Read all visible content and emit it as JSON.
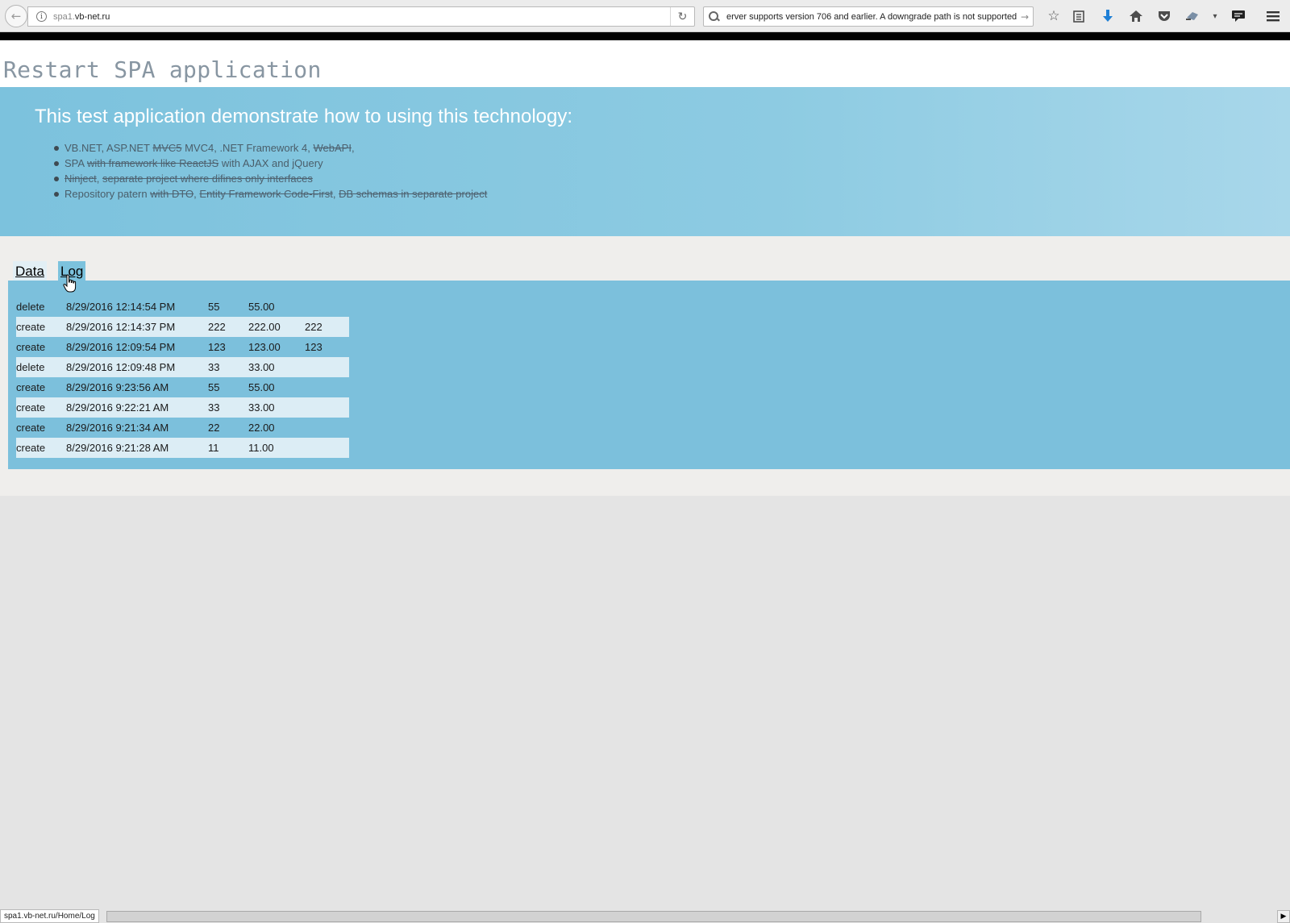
{
  "browser": {
    "url_host": "spa1.",
    "url_domain": "vb-net.ru",
    "search_text": "erver supports version 706 and earlier. A downgrade path is not supported.",
    "status_url": "spa1.vb-net.ru/Home/Log"
  },
  "page": {
    "title": "Restart SPA application",
    "hero_heading": "This test application demonstrate how to using this technology:",
    "tech_items": [
      {
        "parts": [
          {
            "t": "VB.NET, ASP.NET "
          },
          {
            "t": "MVC5",
            "s": true
          },
          {
            "t": " MVC4, .NET Framework 4, "
          },
          {
            "t": "WebAPI",
            "s": true
          },
          {
            "t": ","
          }
        ]
      },
      {
        "parts": [
          {
            "t": "SPA "
          },
          {
            "t": "with framework like ReactJS",
            "s": true
          },
          {
            "t": " with AJAX and jQuery"
          }
        ]
      },
      {
        "parts": [
          {
            "t": "Ninject",
            "s": true
          },
          {
            "t": ", "
          },
          {
            "t": "separate project where difines only interfaces",
            "s": true
          }
        ]
      },
      {
        "parts": [
          {
            "t": "Repository patern "
          },
          {
            "t": "with DTO",
            "s": true
          },
          {
            "t": ", "
          },
          {
            "t": "Entity Framework Code-First",
            "s": true
          },
          {
            "t": ", "
          },
          {
            "t": "DB schemas in separate project",
            "s": true
          }
        ]
      }
    ],
    "tabs": [
      {
        "label": "Data"
      },
      {
        "label": "Log"
      }
    ],
    "log_rows": [
      {
        "action": "delete",
        "date": "8/29/2016 12:14:54 PM",
        "id": "55",
        "price": "55.00",
        "name": ""
      },
      {
        "action": "create",
        "date": "8/29/2016 12:14:37 PM",
        "id": "222",
        "price": "222.00",
        "name": "222"
      },
      {
        "action": "create",
        "date": "8/29/2016 12:09:54 PM",
        "id": "123",
        "price": "123.00",
        "name": "123"
      },
      {
        "action": "delete",
        "date": "8/29/2016 12:09:48 PM",
        "id": "33",
        "price": "33.00",
        "name": ""
      },
      {
        "action": "create",
        "date": "8/29/2016 9:23:56 AM",
        "id": "55",
        "price": "55.00",
        "name": ""
      },
      {
        "action": "create",
        "date": "8/29/2016 9:22:21 AM",
        "id": "33",
        "price": "33.00",
        "name": ""
      },
      {
        "action": "create",
        "date": "8/29/2016 9:21:34 AM",
        "id": "22",
        "price": "22.00",
        "name": ""
      },
      {
        "action": "create",
        "date": "8/29/2016 9:21:28 AM",
        "id": "11",
        "price": "11.00",
        "name": ""
      }
    ]
  },
  "icons": {
    "back": "back-arrow-icon",
    "info": "info-icon",
    "reload": "reload-icon",
    "search": "search-icon",
    "bookmark_star": "star-icon",
    "reading_list": "clipboard-icon",
    "download": "download-arrow-icon",
    "home": "home-icon",
    "pocket": "pocket-icon",
    "sync": "sync-icon",
    "feedback": "speech-bubble-icon",
    "menu": "hamburger-menu-icon"
  },
  "colors": {
    "hero_bg": "#7cc2dd",
    "active_tab": "#7cc2dd",
    "log_panel": "#7cc0dc",
    "row_alt": "#dcedf5",
    "title_text": "#8896a2",
    "download_icon": "#1e7fd6"
  }
}
